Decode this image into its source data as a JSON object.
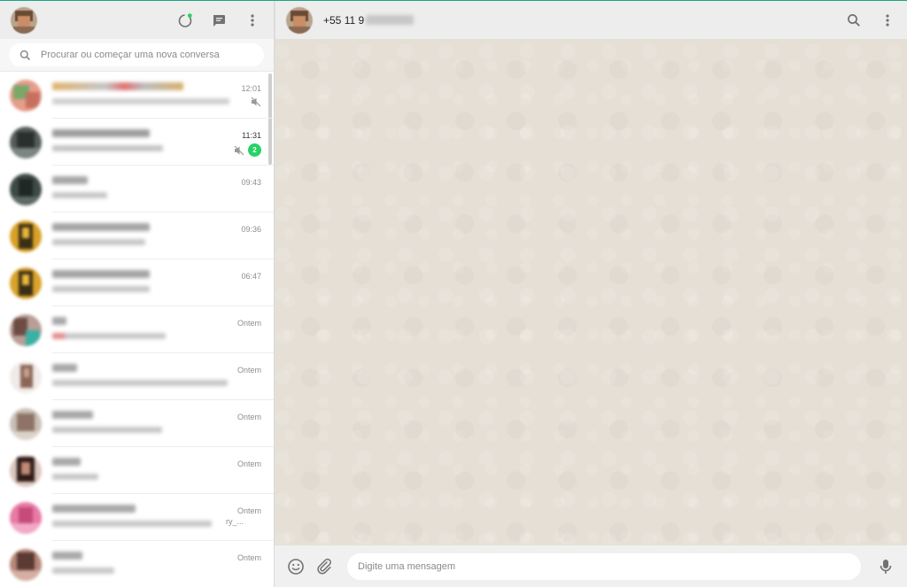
{
  "sidebar": {
    "search": {
      "placeholder": "Procurar ou começar uma nova conversa"
    },
    "chats": [
      {
        "time": "12:01",
        "muted": true,
        "unread": null
      },
      {
        "time": "11:31",
        "muted": true,
        "unread": "2"
      },
      {
        "time": "09:43",
        "muted": false,
        "unread": null
      },
      {
        "time": "09:36",
        "muted": false,
        "unread": null
      },
      {
        "time": "06:47",
        "muted": false,
        "unread": null
      },
      {
        "time": "Ontem",
        "muted": false,
        "unread": null
      },
      {
        "time": "Ontem",
        "muted": false,
        "unread": null
      },
      {
        "time": "Ontem",
        "muted": false,
        "unread": null
      },
      {
        "time": "Ontem",
        "muted": false,
        "unread": null
      },
      {
        "time": "Ontem",
        "muted": false,
        "unread": null
      },
      {
        "time": "Ontem",
        "muted": false,
        "unread": null
      }
    ],
    "snippet_fragment": "ry_..."
  },
  "conversation": {
    "contact": {
      "number_prefix": "+55 11 9"
    },
    "composer": {
      "placeholder": "Digite uma mensagem"
    }
  },
  "colors": {
    "accent": "#1fa385",
    "unread_badge": "#25d366",
    "header_bg": "#ededed",
    "wallpaper": "#e5dfd5"
  },
  "icons": {
    "status": "status-icon",
    "new_chat": "new-chat-icon",
    "menu": "menu-icon",
    "search": "search-icon",
    "mute": "muted-icon",
    "emoji": "emoji-icon",
    "attach": "attach-icon",
    "mic": "mic-icon"
  }
}
